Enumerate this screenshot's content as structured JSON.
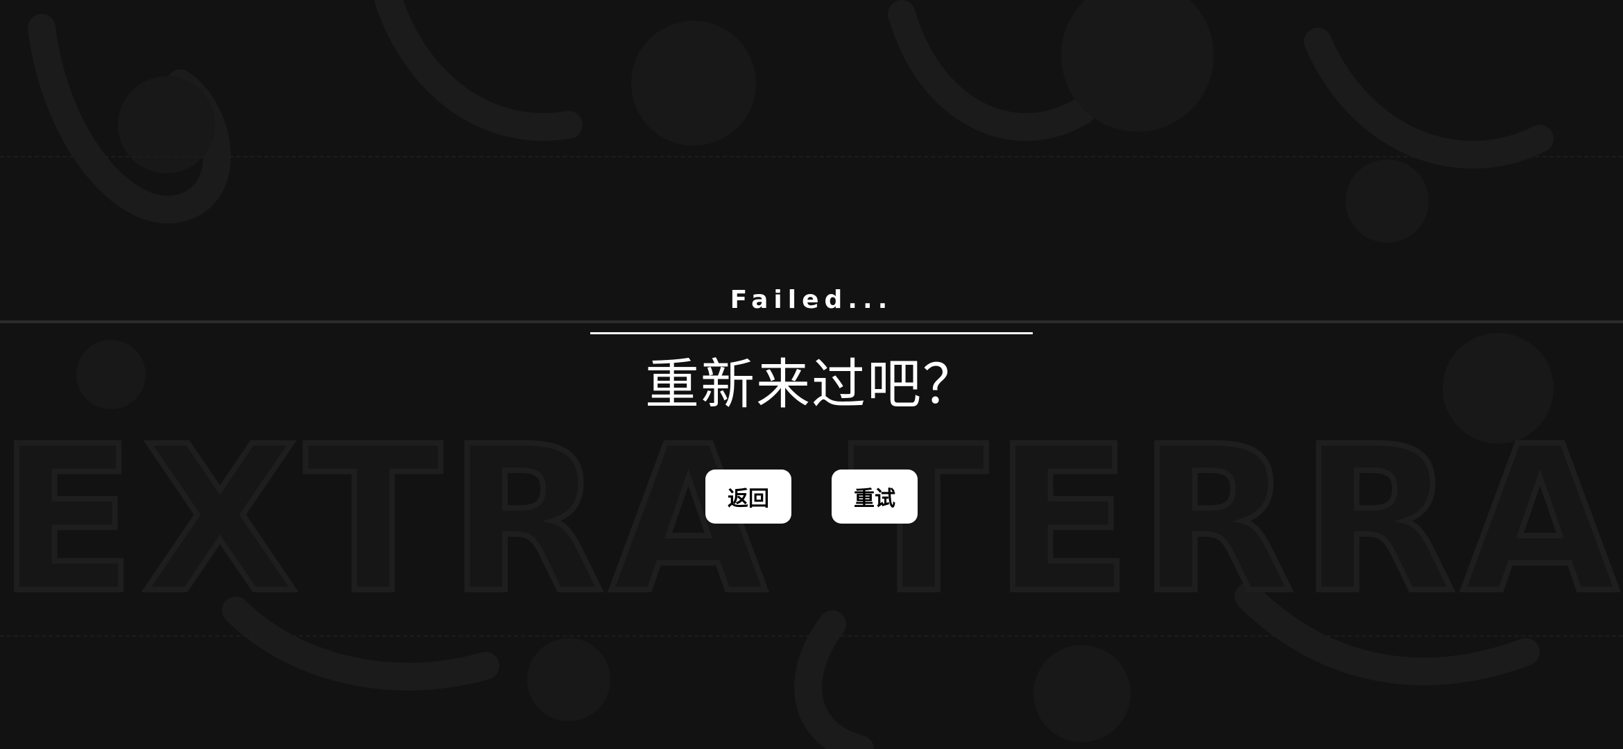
{
  "dialog": {
    "status_title": "Failed...",
    "prompt": "重新来过吧？",
    "back_label": "返回",
    "retry_label": "重试"
  },
  "background": {
    "logo_text": "EXTRA TERRA",
    "base_color": "#121212",
    "art_color": "#1a1a1a"
  },
  "colors": {
    "text": "#ffffff",
    "button_bg": "#ffffff",
    "button_text": "#000000",
    "divider": "#2c2c2c"
  }
}
